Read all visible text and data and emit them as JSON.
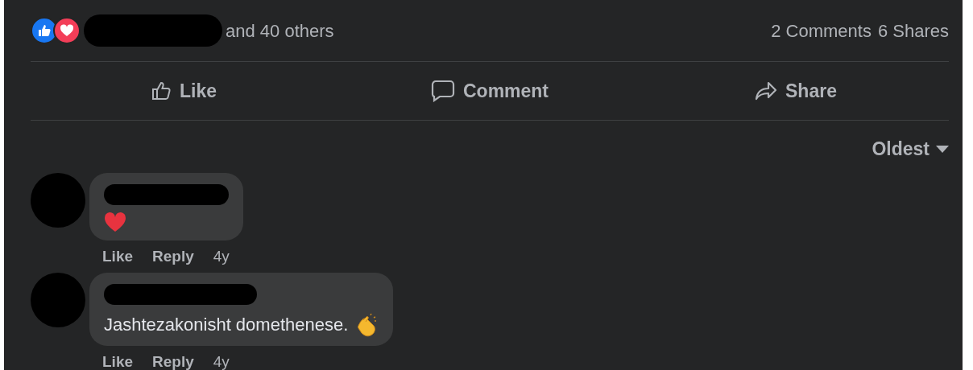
{
  "reactions": {
    "icons": [
      {
        "kind": "like"
      },
      {
        "kind": "love"
      }
    ],
    "names_redacted": true,
    "others": "and 40 others",
    "comments_count": "2 Comments",
    "shares_count": "6 Shares"
  },
  "actions": [
    {
      "kind": "like",
      "label": "Like"
    },
    {
      "kind": "comment",
      "label": "Comment"
    },
    {
      "kind": "share",
      "label": "Share"
    }
  ],
  "sort": {
    "label": "Oldest"
  },
  "comments": [
    {
      "name_redacted": true,
      "emoji": {
        "kind": "heart"
      },
      "actions": [
        "Like",
        "Reply"
      ],
      "time": "4y"
    },
    {
      "name_redacted": true,
      "text": "Jashtezakonisht domethenese.",
      "emoji": {
        "kind": "clap"
      },
      "actions": [
        "Like",
        "Reply"
      ],
      "time": "4y"
    }
  ]
}
